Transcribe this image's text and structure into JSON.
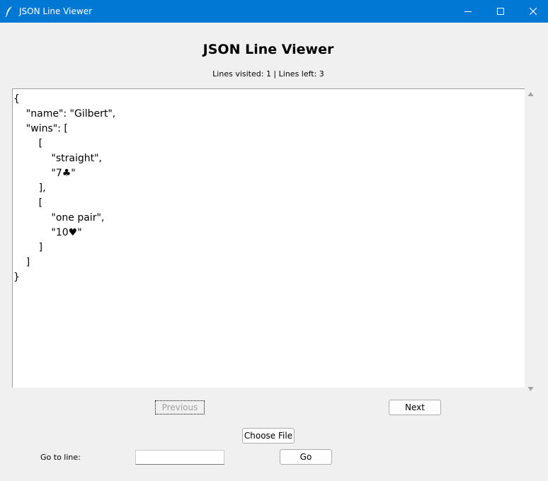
{
  "window": {
    "title": "JSON Line Viewer",
    "title_bar_color": "#0078d4",
    "icon": "feather-icon",
    "controls": {
      "minimize_icon": "minimize-icon",
      "maximize_icon": "maximize-icon",
      "close_icon": "close-icon"
    }
  },
  "main": {
    "heading": "JSON Line Viewer",
    "status": "Lines visited: 1 | Lines left: 3"
  },
  "viewer": {
    "lines": [
      "{",
      "    \"name\": \"Gilbert\",",
      "    \"wins\": [",
      "        [",
      "            \"straight\",",
      "            \"7♣\"",
      "        ],",
      "        [",
      "            \"one pair\",",
      "            \"10♥\"",
      "        ]",
      "    ]",
      "}"
    ]
  },
  "navigation": {
    "previous_label": "Previous",
    "previous_disabled": true,
    "next_label": "Next"
  },
  "file": {
    "choose_label": "Choose File"
  },
  "goto": {
    "label": "Go to line:",
    "input_value": "",
    "go_label": "Go"
  }
}
